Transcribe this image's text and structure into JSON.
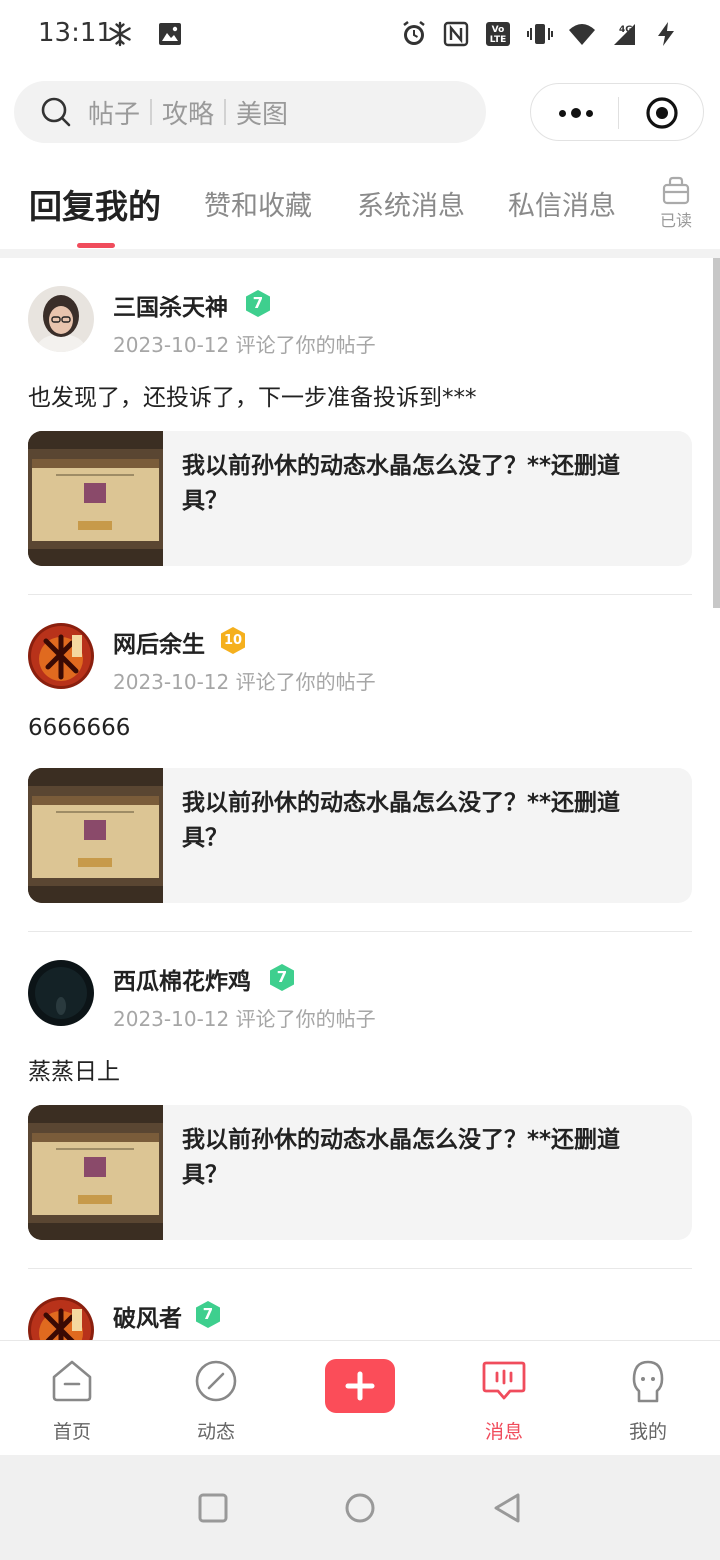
{
  "status_bar": {
    "time": "13:11",
    "left_icons": [
      "snowflake-icon",
      "image-icon"
    ],
    "right_icons": [
      "alarm-icon",
      "nfc-icon",
      "volte-icon",
      "vibrate-icon",
      "wifi-icon",
      "signal-4g-icon",
      "charging-icon"
    ],
    "network_label": "4G",
    "volte_label": "Vo LTE"
  },
  "search": {
    "keywords": [
      "帖子",
      "攻略",
      "美图"
    ]
  },
  "tabs": {
    "items": [
      {
        "label": "回复我的",
        "active": true
      },
      {
        "label": "赞和收藏",
        "active": false
      },
      {
        "label": "系统消息",
        "active": false
      },
      {
        "label": "私信消息",
        "active": false
      }
    ],
    "read_all_label": "已读"
  },
  "messages": [
    {
      "username": "三国杀天神",
      "level": "7",
      "level_color": "#3ecf8e",
      "date": "2023-10-12",
      "action": "评论了你的帖子",
      "comment": "也发现了，还投诉了，下一步准备投诉到***",
      "post_title": "我以前孙休的动态水晶怎么没了？**还删道具？"
    },
    {
      "username": "网后余生",
      "level": "10",
      "level_color": "#f5b01d",
      "date": "2023-10-12",
      "action": "评论了你的帖子",
      "comment": "6666666",
      "post_title": "我以前孙休的动态水晶怎么没了？**还删道具？"
    },
    {
      "username": "西瓜棉花炸鸡",
      "level": "7",
      "level_color": "#3ecf8e",
      "date": "2023-10-12",
      "action": "评论了你的帖子",
      "comment": "蒸蒸日上",
      "post_title": "我以前孙休的动态水晶怎么没了？**还删道具？"
    },
    {
      "username": "破风者",
      "level": "7",
      "level_color": "#3ecf8e"
    }
  ],
  "bottom_nav": {
    "items": [
      {
        "label": "首页",
        "icon": "home-icon",
        "active": false
      },
      {
        "label": "动态",
        "icon": "compass-icon",
        "active": false
      },
      {
        "label": "消息",
        "icon": "message-icon",
        "active": true
      },
      {
        "label": "我的",
        "icon": "profile-icon",
        "active": false
      }
    ],
    "publish_icon": "plus-icon"
  },
  "colors": {
    "accent": "#f04c5c",
    "publish": "#fb4d59",
    "level_green": "#3ecf8e",
    "level_gold": "#f5b01d"
  }
}
